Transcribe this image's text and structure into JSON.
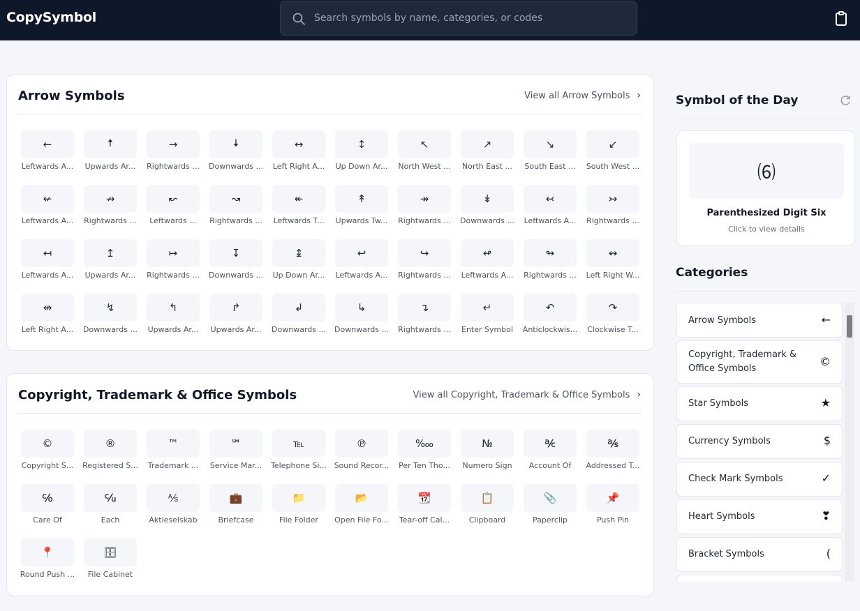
{
  "app": {
    "logo": "CopySymbol",
    "search_placeholder": "Search symbols by name, categories, or codes"
  },
  "sections": [
    {
      "title": "Arrow Symbols",
      "view_all": "View all Arrow Symbols",
      "symbols": [
        {
          "char": "←",
          "label": "Leftwards A..."
        },
        {
          "char": "🠅",
          "label": "Upwards Ar..."
        },
        {
          "char": "→",
          "label": "Rightwards ..."
        },
        {
          "char": "🠇",
          "label": "Downwards ..."
        },
        {
          "char": "↔",
          "label": "Left Right A..."
        },
        {
          "char": "↕",
          "label": "Up Down Ar..."
        },
        {
          "char": "↖",
          "label": "North West ..."
        },
        {
          "char": "↗",
          "label": "North East ..."
        },
        {
          "char": "↘",
          "label": "South East ..."
        },
        {
          "char": "↙",
          "label": "South West ..."
        },
        {
          "char": "↚",
          "label": "Leftwards A..."
        },
        {
          "char": "↛",
          "label": "Rightwards ..."
        },
        {
          "char": "↜",
          "label": "Leftwards ..."
        },
        {
          "char": "↝",
          "label": "Rightwards ..."
        },
        {
          "char": "↞",
          "label": "Leftwards T..."
        },
        {
          "char": "↟",
          "label": "Upwards Tw..."
        },
        {
          "char": "↠",
          "label": "Rightwards ..."
        },
        {
          "char": "↡",
          "label": "Downwards ..."
        },
        {
          "char": "↢",
          "label": "Leftwards A..."
        },
        {
          "char": "↣",
          "label": "Rightwards ..."
        },
        {
          "char": "↤",
          "label": "Leftwards A..."
        },
        {
          "char": "↥",
          "label": "Upwards Ar..."
        },
        {
          "char": "↦",
          "label": "Rightwards ..."
        },
        {
          "char": "↧",
          "label": "Downwards ..."
        },
        {
          "char": "↨",
          "label": "Up Down Ar..."
        },
        {
          "char": "↩",
          "label": "Leftwards A..."
        },
        {
          "char": "↪",
          "label": "Rightwards ..."
        },
        {
          "char": "↫",
          "label": "Leftwards A..."
        },
        {
          "char": "↬",
          "label": "Rightwards ..."
        },
        {
          "char": "↭",
          "label": "Left Right W..."
        },
        {
          "char": "↮",
          "label": "Left Right A..."
        },
        {
          "char": "↯",
          "label": "Downwards ..."
        },
        {
          "char": "↰",
          "label": "Upwards Ar..."
        },
        {
          "char": "↱",
          "label": "Upwards Ar..."
        },
        {
          "char": "↲",
          "label": "Downwards ..."
        },
        {
          "char": "↳",
          "label": "Downwards ..."
        },
        {
          "char": "↴",
          "label": "Rightwards ..."
        },
        {
          "char": "↵",
          "label": "Enter Symbol"
        },
        {
          "char": "↶",
          "label": "Anticlockwis..."
        },
        {
          "char": "↷",
          "label": "Clockwise T..."
        }
      ]
    },
    {
      "title": "Copyright, Trademark & Office Symbols",
      "view_all": "View all Copyright, Trademark & Office Symbols",
      "symbols": [
        {
          "char": "©",
          "label": "Copyright S..."
        },
        {
          "char": "®",
          "label": "Registered S..."
        },
        {
          "char": "™",
          "label": "Trademark ..."
        },
        {
          "char": "℠",
          "label": "Service Mar..."
        },
        {
          "char": "℡",
          "label": "Telephone Si..."
        },
        {
          "char": "℗",
          "label": "Sound Recor..."
        },
        {
          "char": "‱",
          "label": "Per Ten Tho..."
        },
        {
          "char": "№",
          "label": "Numero Sign"
        },
        {
          "char": "℀",
          "label": "Account Of"
        },
        {
          "char": "℁",
          "label": "Addressed T..."
        },
        {
          "char": "℅",
          "label": "Care Of"
        },
        {
          "char": "℆",
          "label": "Each"
        },
        {
          "char": "⅍",
          "label": "Aktieselskab"
        },
        {
          "char": "💼",
          "label": "Briefcase"
        },
        {
          "char": "📁",
          "label": "File Folder"
        },
        {
          "char": "📂",
          "label": "Open File Fo..."
        },
        {
          "char": "📆",
          "label": "Tear-off Cal..."
        },
        {
          "char": "📋",
          "label": "Clipboard"
        },
        {
          "char": "📎",
          "label": "Paperclip"
        },
        {
          "char": "📌",
          "label": "Push Pin"
        },
        {
          "char": "📍",
          "label": "Round Push ..."
        },
        {
          "char": "🗄",
          "label": "File Cabinet"
        }
      ]
    }
  ],
  "sidebar": {
    "sotd_title": "Symbol of the Day",
    "sotd_char": "⑹",
    "sotd_name": "Parenthesized Digit Six",
    "sotd_hint": "Click to view details",
    "categories_title": "Categories",
    "categories": [
      {
        "name": "Arrow Symbols",
        "char": "←"
      },
      {
        "name": "Copyright, Trademark & Office Symbols",
        "char": "©"
      },
      {
        "name": "Star Symbols",
        "char": "★"
      },
      {
        "name": "Currency Symbols",
        "char": "$"
      },
      {
        "name": "Check Mark Symbols",
        "char": "✓"
      },
      {
        "name": "Heart Symbols",
        "char": "❣"
      },
      {
        "name": "Bracket Symbols",
        "char": "("
      },
      {
        "name": "",
        "char": ""
      }
    ]
  }
}
